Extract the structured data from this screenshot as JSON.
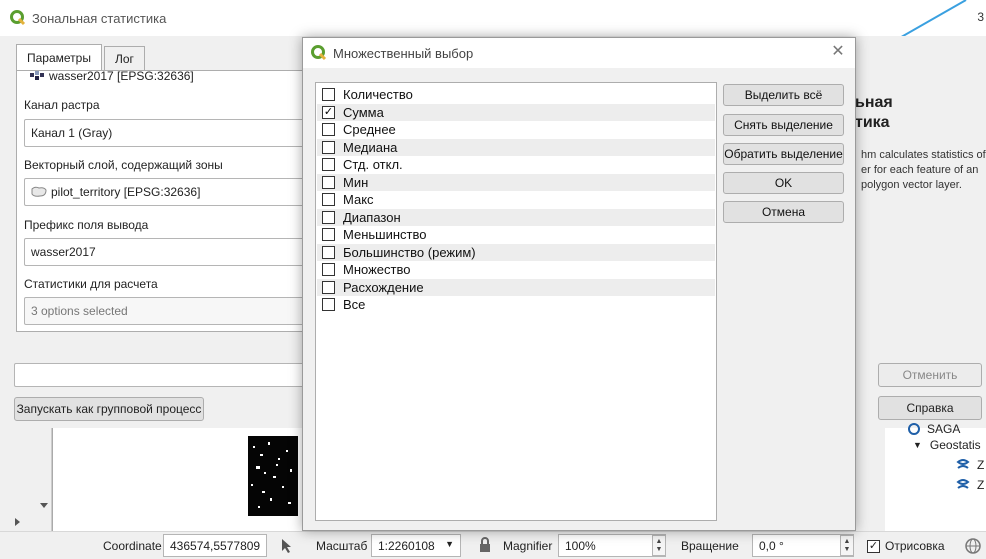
{
  "window": {
    "title": "Зональная статистика",
    "corner_digit": "3"
  },
  "tabs": [
    {
      "label": "Параметры"
    },
    {
      "label": "Лог"
    }
  ],
  "params": {
    "raster_layer_value": "wasser2017 [EPSG:32636]",
    "band_label": "Канал растра",
    "band_value": "Канал 1 (Gray)",
    "vector_label": "Векторный слой, содержащий зоны",
    "vector_value": "pilot_territory [EPSG:32636]",
    "prefix_label": "Префикс поля вывода",
    "prefix_value": "wasser2017",
    "stats_label": "Статистики для расчета",
    "stats_value": "3 options selected"
  },
  "help": {
    "title_line1": "ьная",
    "title_line2": "тика",
    "text_line1": "hm calculates statistics of",
    "text_line2": "er for each feature of an",
    "text_line3": "polygon vector layer."
  },
  "buttons": {
    "batch": "Запускать как групповой процесс",
    "cancel": "Отменить",
    "help": "Справка"
  },
  "tree": {
    "item_saga": "SAGA",
    "item_geostat": "Geostatis",
    "item_z1": "Z",
    "item_z2": "Z"
  },
  "statusbar": {
    "coordinate_label": "Coordinate",
    "coordinate_value": "436574,5577809",
    "scale_label": "Масштаб",
    "scale_value": "1:2260108",
    "magnifier_label": "Magnifier",
    "magnifier_value": "100%",
    "rotation_label": "Вращение",
    "rotation_value": "0,0 °",
    "render_label": "Отрисовка",
    "render_checked": true
  },
  "dialog": {
    "title": "Множественный выбор",
    "options": [
      {
        "label": "Количество",
        "checked": false
      },
      {
        "label": "Сумма",
        "checked": true
      },
      {
        "label": "Среднее",
        "checked": false
      },
      {
        "label": "Медиана",
        "checked": false
      },
      {
        "label": "Стд. откл.",
        "checked": false
      },
      {
        "label": "Мин",
        "checked": false
      },
      {
        "label": "Макс",
        "checked": false
      },
      {
        "label": "Диапазон",
        "checked": false
      },
      {
        "label": "Меньшинство",
        "checked": false
      },
      {
        "label": "Большинство (режим)",
        "checked": false
      },
      {
        "label": "Множество",
        "checked": false
      },
      {
        "label": "Расхождение",
        "checked": false
      },
      {
        "label": "Все",
        "checked": false
      }
    ],
    "buttons": {
      "select_all": "Выделить всё",
      "clear_selection": "Снять выделение",
      "invert_selection": "Обратить выделение",
      "ok": "OK",
      "cancel": "Отмена"
    }
  },
  "colors": {
    "qgis_green": "#5a9e2f",
    "accent_blue": "#3aa0e0"
  }
}
